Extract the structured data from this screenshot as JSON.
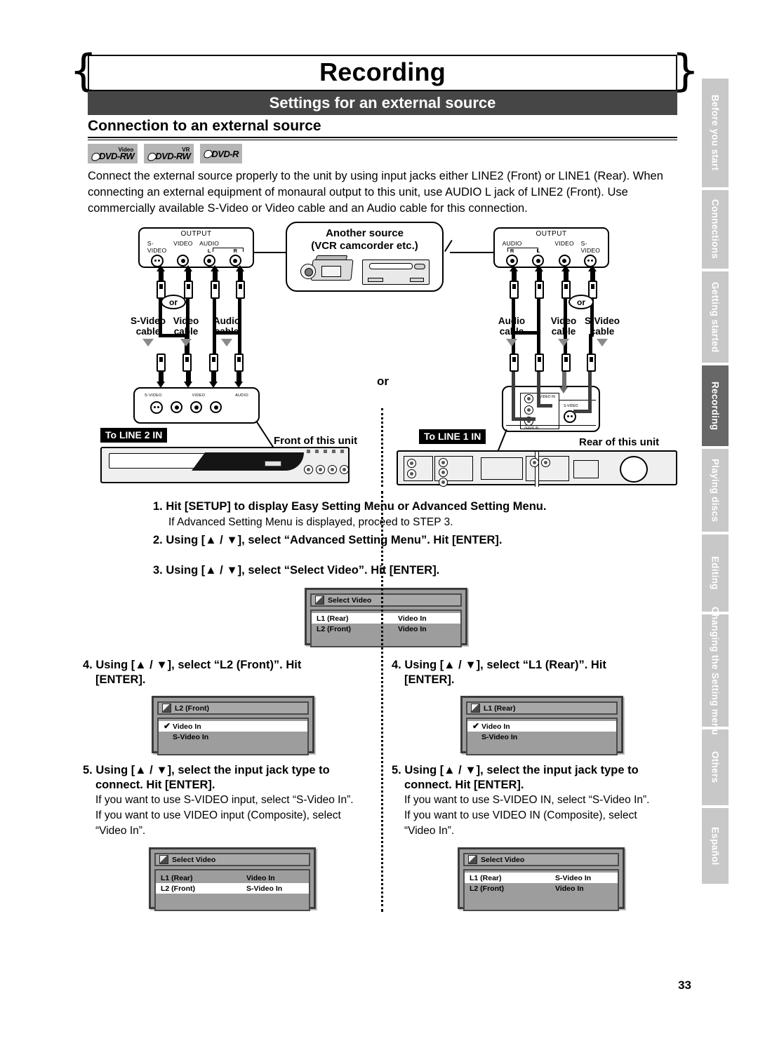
{
  "header": {
    "chapter_title": "Recording",
    "section_title": "Settings for an external source",
    "sub_title": "Connection to an external source"
  },
  "disc_badges": [
    {
      "sup": "Video",
      "label": "DVD-RW"
    },
    {
      "sup": "VR",
      "label": "DVD-RW"
    },
    {
      "sup": "",
      "label": "DVD-R"
    }
  ],
  "intro": "Connect the external source properly to the unit by using input jacks either LINE2 (Front) or LINE1 (Rear). When connecting an external equipment of monaural output to this unit, use AUDIO L jack of LINE2 (Front). Use commercially available S-Video or Video cable and an Audio cable for this connection.",
  "side_tabs": [
    {
      "label": "Before you start",
      "active": false
    },
    {
      "label": "Connections",
      "active": false
    },
    {
      "label": "Getting started",
      "active": false
    },
    {
      "label": "Recording",
      "active": true
    },
    {
      "label": "Playing discs",
      "active": false
    },
    {
      "label": "Editing",
      "active": false
    },
    {
      "label": "Changing the Setting menu",
      "active": false
    },
    {
      "label": "Others",
      "active": false
    },
    {
      "label": "Español",
      "active": false
    }
  ],
  "diagram": {
    "source_callout_line1": "Another source",
    "source_callout_line2": "(VCR camcorder etc.)",
    "middle_or": "or",
    "left": {
      "output_title": "OUTPUT",
      "jacks": [
        "S-VIDEO",
        "VIDEO",
        "AUDIO"
      ],
      "audio_channels": [
        "L",
        "R"
      ],
      "or_bubble": "or",
      "cable_labels": [
        "S-Video\ncable",
        "Video\ncable",
        "Audio\ncable"
      ],
      "cable_label_1a": "S-Video",
      "cable_label_1b": "cable",
      "cable_label_2a": "Video",
      "cable_label_2b": "cable",
      "cable_label_3a": "Audio",
      "cable_label_3b": "cable",
      "to_tag": "To LINE 2 IN",
      "unit_caption": "Front of this unit",
      "unit_jack_labels": [
        "S-VIDEO",
        "VIDEO",
        "AUDIO"
      ]
    },
    "right": {
      "output_title": "OUTPUT",
      "jacks": [
        "AUDIO",
        "VIDEO",
        "S-VIDEO"
      ],
      "audio_channels": [
        "R",
        "L"
      ],
      "or_bubble": "or",
      "cable_label_1a": "Audio",
      "cable_label_1b": "cable",
      "cable_label_2a": "Video",
      "cable_label_2b": "cable",
      "cable_label_3a": "S-Video",
      "cable_label_3b": "cable",
      "to_tag": "To LINE 1 IN",
      "unit_caption": "Rear of this unit",
      "rear_jack_labels": [
        "VIDEO IN",
        "S-VIDEO",
        "AUDIO IN"
      ]
    }
  },
  "steps": {
    "step1_bold": "1. Hit [SETUP] to display Easy Setting Menu or Advanced Setting Menu.",
    "step1_note": "If Advanced Setting Menu is displayed, proceed to STEP 3.",
    "step2_bold": "2. Using [▲ / ▼], select “Advanced Setting Menu”. Hit [ENTER].",
    "step3_bold": "3. Using [▲ / ▼], select “Select Video”. Hit [ENTER]."
  },
  "left_column": {
    "step4_line1": "4. Using [▲ / ▼], select “L2 (Front)”. Hit",
    "step4_line2": "[ENTER].",
    "step5_line1": "5. Using [▲ / ▼], select the input jack type to",
    "step5_line2": "connect. Hit [ENTER].",
    "step5_note1": "If you want to use S-VIDEO input, select “S-Video In”.",
    "step5_note2": "If you want to use VIDEO input (Composite), select",
    "step5_note3": "“Video In”."
  },
  "right_column": {
    "step4_line1": "4. Using [▲ / ▼], select “L1 (Rear)”. Hit",
    "step4_line2": "[ENTER].",
    "step5_line1": "5. Using [▲ / ▼], select the input jack type to",
    "step5_line2": "connect. Hit [ENTER].",
    "step5_note1": "If you want to use S-VIDEO IN, select “S-Video In”.",
    "step5_note2": "If you want to use VIDEO IN (Composite), select",
    "step5_note3": "“Video In”."
  },
  "osd": {
    "step3_screen": {
      "title": "Select Video",
      "rows": [
        {
          "name": "L1 (Rear)",
          "value": "Video In",
          "selected": true,
          "check": false
        },
        {
          "name": "L2 (Front)",
          "value": "Video In",
          "selected": false,
          "check": false
        }
      ]
    },
    "step4_left_screen": {
      "title": "L2 (Front)",
      "rows": [
        {
          "name": "Video In",
          "value": "",
          "selected": true,
          "check": true
        },
        {
          "name": "S-Video In",
          "value": "",
          "selected": false,
          "check": false
        }
      ]
    },
    "step4_right_screen": {
      "title": "L1 (Rear)",
      "rows": [
        {
          "name": "Video In",
          "value": "",
          "selected": true,
          "check": true
        },
        {
          "name": "S-Video In",
          "value": "",
          "selected": false,
          "check": false
        }
      ]
    },
    "step5_left_screen": {
      "title": "Select Video",
      "rows": [
        {
          "name": "L1 (Rear)",
          "value": "Video In",
          "selected": false,
          "check": false
        },
        {
          "name": "L2 (Front)",
          "value": "S-Video In",
          "selected": true,
          "check": false
        }
      ]
    },
    "step5_right_screen": {
      "title": "Select Video",
      "rows": [
        {
          "name": "L1 (Rear)",
          "value": "S-Video In",
          "selected": true,
          "check": false
        },
        {
          "name": "L2 (Front)",
          "value": "Video In",
          "selected": false,
          "check": false
        }
      ]
    }
  },
  "page_number": "33"
}
